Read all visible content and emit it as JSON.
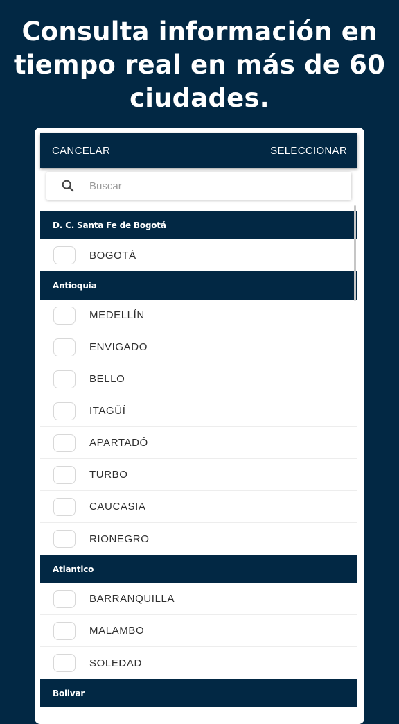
{
  "headline": {
    "line1": "Consulta información en",
    "line2": "tiempo real en más de 60",
    "line3": "ciudades."
  },
  "toolbar": {
    "cancel_label": "CANCELAR",
    "select_label": "SELECCIONAR"
  },
  "search": {
    "placeholder": "Buscar",
    "icon": "search-icon"
  },
  "colors": {
    "background": "#022844",
    "section_header": "#022844",
    "surface": "#ffffff"
  },
  "sections": [
    {
      "name": "D. C. Santa Fe de Bogotá",
      "cities": [
        "BOGOTÁ"
      ]
    },
    {
      "name": "Antioquia",
      "cities": [
        "MEDELLÍN",
        "ENVIGADO",
        "BELLO",
        "ITAGÜÍ",
        "APARTADÓ",
        "TURBO",
        "CAUCASIA",
        "RIONEGRO"
      ]
    },
    {
      "name": "Atlantico",
      "cities": [
        "BARRANQUILLA",
        "MALAMBO",
        "SOLEDAD"
      ]
    },
    {
      "name": "Bolivar",
      "cities": []
    }
  ]
}
